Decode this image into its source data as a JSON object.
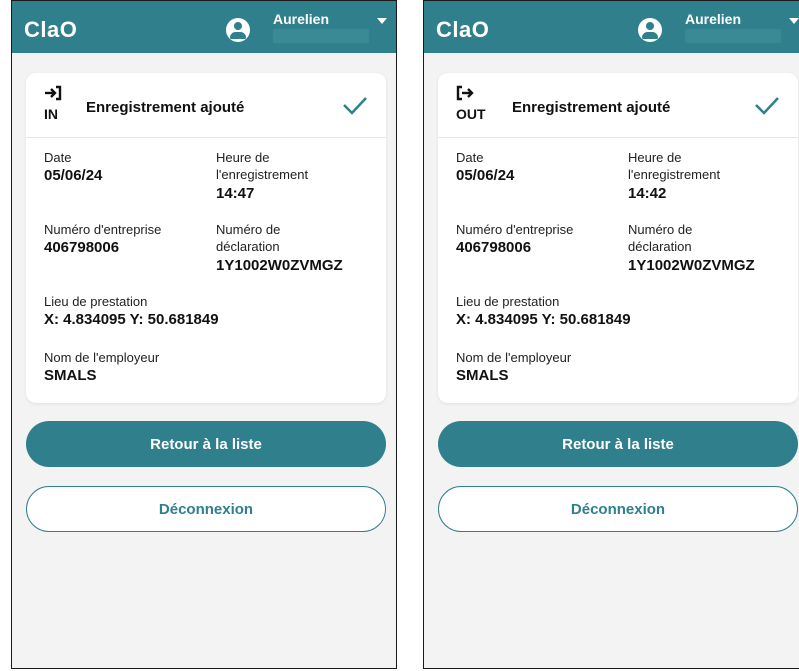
{
  "colors": {
    "primary": "#2f7f8c",
    "background": "#f3f3f3",
    "card": "#ffffff"
  },
  "screens": [
    {
      "app_title": "ClaO",
      "user_name": "Aurelien",
      "direction_icon": "sign-in-icon",
      "direction_label": "IN",
      "card_title": "Enregistrement ajouté",
      "date_label": "Date",
      "date_value": "05/06/24",
      "heure_label_1": "Heure de",
      "heure_label_2": "l'enregistrement",
      "heure_value": "14:47",
      "entreprise_label": "Numéro d'entreprise",
      "entreprise_value": "406798006",
      "declaration_label_1": "Numéro de",
      "declaration_label_2": "déclaration",
      "declaration_value": "1Y1002W0ZVMGZ",
      "lieu_label": "Lieu de prestation",
      "lieu_value": "X: 4.834095 Y: 50.681849",
      "employeur_label": "Nom de l'employeur",
      "employeur_value": "SMALS",
      "retour_label": "Retour à la liste",
      "deconnexion_label": "Déconnexion"
    },
    {
      "app_title": "ClaO",
      "user_name": "Aurelien",
      "direction_icon": "sign-out-icon",
      "direction_label": "OUT",
      "card_title": "Enregistrement ajouté",
      "date_label": "Date",
      "date_value": "05/06/24",
      "heure_label_1": "Heure de",
      "heure_label_2": "l'enregistrement",
      "heure_value": "14:42",
      "entreprise_label": "Numéro d'entreprise",
      "entreprise_value": "406798006",
      "declaration_label_1": "Numéro de",
      "declaration_label_2": "déclaration",
      "declaration_value": "1Y1002W0ZVMGZ",
      "lieu_label": "Lieu de prestation",
      "lieu_value": "X: 4.834095 Y: 50.681849",
      "employeur_label": "Nom de l'employeur",
      "employeur_value": "SMALS",
      "retour_label": "Retour à la liste",
      "deconnexion_label": "Déconnexion"
    }
  ]
}
